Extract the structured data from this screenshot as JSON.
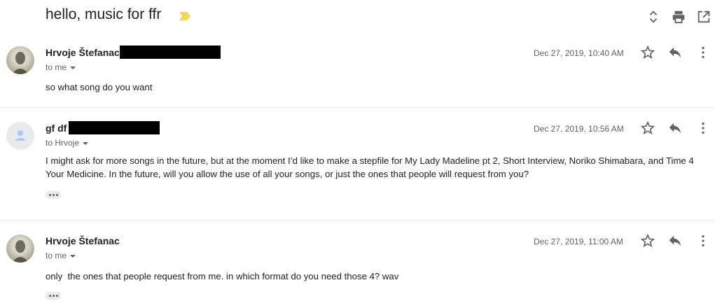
{
  "thread": {
    "subject": "hello, music for ffr",
    "toolbar": {
      "expand_icon": "unfold-icon",
      "print_icon": "print-icon",
      "popout_icon": "open-in-new-icon"
    },
    "messages": [
      {
        "sender": "Hrvoje Štefanac",
        "recipient": "to me",
        "date": "Dec 27, 2019, 10:40 AM",
        "body": "so what song do you want"
      },
      {
        "sender": "gf df",
        "recipient": "to Hrvoje",
        "date": "Dec 27, 2019, 10:56 AM",
        "body": "I might ask for more songs in the future, but at the moment I’d like to make a stepfile for My Lady Madeline pt 2, Short Interview, Noriko Shimabara, and Time 4 Your Medicine. In the future, will you allow the use of all your songs, or just the ones that people will request from you?"
      },
      {
        "sender": "Hrvoje Štefanac",
        "recipient": "to me",
        "date": "Dec 27, 2019, 11:00 AM",
        "body": "only  the ones that people request from me. in which format do you need those 4? wav"
      }
    ]
  },
  "colors": {
    "importance_marker": "#f6d35b",
    "text_primary": "#202124",
    "text_secondary": "#5f6368",
    "divider": "#ececec",
    "redaction": "#000000"
  }
}
